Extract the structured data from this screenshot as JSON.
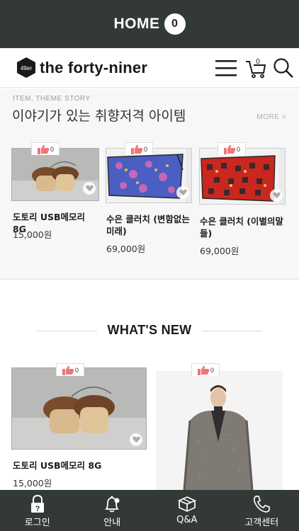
{
  "topbar": {
    "title": "HOME",
    "badge": "0"
  },
  "header": {
    "logo_text": "49er",
    "brand": "the forty-niner",
    "cart_count": "0"
  },
  "story": {
    "subtitle": "ITEM, THEME STORY",
    "title": "이야기가 있는 취향저격 아이템",
    "more": "MORE >",
    "products": [
      {
        "name": "도토리 USB메모리 8G",
        "price": "15,000원",
        "likes": "0"
      },
      {
        "name": "수은 클러치 (변함없는 미래)",
        "price": "69,000원",
        "likes": "0"
      },
      {
        "name": "수은 클러치 (이별의말들)",
        "price": "69,000원",
        "likes": "0"
      }
    ]
  },
  "whats_new": {
    "title": "WHAT'S NEW",
    "products": [
      {
        "name": "도토리 USB메모리 8G",
        "price": "15,000원",
        "likes": "0"
      },
      {
        "likes": "0"
      }
    ]
  },
  "bottom_nav": {
    "items": [
      {
        "label": "로그인",
        "icon": "lock-icon"
      },
      {
        "label": "안내",
        "icon": "bell-icon"
      },
      {
        "label": "Q&A",
        "icon": "box-icon"
      },
      {
        "label": "고객센터",
        "icon": "phone-icon"
      }
    ]
  },
  "colors": {
    "dark_bar": "#333a36",
    "background_section": "#f7f7f7"
  }
}
